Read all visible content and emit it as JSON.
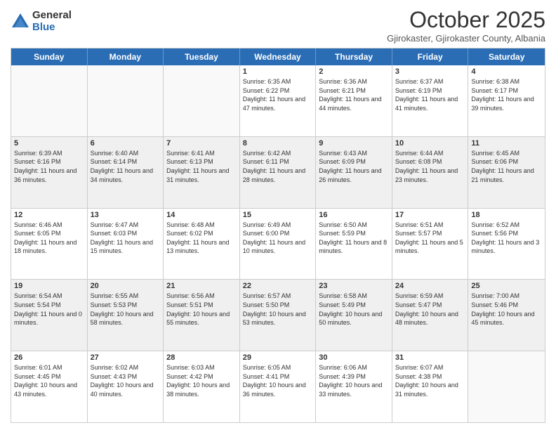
{
  "logo": {
    "general": "General",
    "blue": "Blue"
  },
  "header": {
    "month": "October 2025",
    "subtitle": "Gjirokaster, Gjirokaster County, Albania"
  },
  "days": [
    "Sunday",
    "Monday",
    "Tuesday",
    "Wednesday",
    "Thursday",
    "Friday",
    "Saturday"
  ],
  "rows": [
    [
      {
        "day": "",
        "info": "",
        "empty": true
      },
      {
        "day": "",
        "info": "",
        "empty": true
      },
      {
        "day": "",
        "info": "",
        "empty": true
      },
      {
        "day": "1",
        "info": "Sunrise: 6:35 AM\nSunset: 6:22 PM\nDaylight: 11 hours and 47 minutes.",
        "empty": false
      },
      {
        "day": "2",
        "info": "Sunrise: 6:36 AM\nSunset: 6:21 PM\nDaylight: 11 hours and 44 minutes.",
        "empty": false
      },
      {
        "day": "3",
        "info": "Sunrise: 6:37 AM\nSunset: 6:19 PM\nDaylight: 11 hours and 41 minutes.",
        "empty": false
      },
      {
        "day": "4",
        "info": "Sunrise: 6:38 AM\nSunset: 6:17 PM\nDaylight: 11 hours and 39 minutes.",
        "empty": false
      }
    ],
    [
      {
        "day": "5",
        "info": "Sunrise: 6:39 AM\nSunset: 6:16 PM\nDaylight: 11 hours and 36 minutes.",
        "empty": false
      },
      {
        "day": "6",
        "info": "Sunrise: 6:40 AM\nSunset: 6:14 PM\nDaylight: 11 hours and 34 minutes.",
        "empty": false
      },
      {
        "day": "7",
        "info": "Sunrise: 6:41 AM\nSunset: 6:13 PM\nDaylight: 11 hours and 31 minutes.",
        "empty": false
      },
      {
        "day": "8",
        "info": "Sunrise: 6:42 AM\nSunset: 6:11 PM\nDaylight: 11 hours and 28 minutes.",
        "empty": false
      },
      {
        "day": "9",
        "info": "Sunrise: 6:43 AM\nSunset: 6:09 PM\nDaylight: 11 hours and 26 minutes.",
        "empty": false
      },
      {
        "day": "10",
        "info": "Sunrise: 6:44 AM\nSunset: 6:08 PM\nDaylight: 11 hours and 23 minutes.",
        "empty": false
      },
      {
        "day": "11",
        "info": "Sunrise: 6:45 AM\nSunset: 6:06 PM\nDaylight: 11 hours and 21 minutes.",
        "empty": false
      }
    ],
    [
      {
        "day": "12",
        "info": "Sunrise: 6:46 AM\nSunset: 6:05 PM\nDaylight: 11 hours and 18 minutes.",
        "empty": false
      },
      {
        "day": "13",
        "info": "Sunrise: 6:47 AM\nSunset: 6:03 PM\nDaylight: 11 hours and 15 minutes.",
        "empty": false
      },
      {
        "day": "14",
        "info": "Sunrise: 6:48 AM\nSunset: 6:02 PM\nDaylight: 11 hours and 13 minutes.",
        "empty": false
      },
      {
        "day": "15",
        "info": "Sunrise: 6:49 AM\nSunset: 6:00 PM\nDaylight: 11 hours and 10 minutes.",
        "empty": false
      },
      {
        "day": "16",
        "info": "Sunrise: 6:50 AM\nSunset: 5:59 PM\nDaylight: 11 hours and 8 minutes.",
        "empty": false
      },
      {
        "day": "17",
        "info": "Sunrise: 6:51 AM\nSunset: 5:57 PM\nDaylight: 11 hours and 5 minutes.",
        "empty": false
      },
      {
        "day": "18",
        "info": "Sunrise: 6:52 AM\nSunset: 5:56 PM\nDaylight: 11 hours and 3 minutes.",
        "empty": false
      }
    ],
    [
      {
        "day": "19",
        "info": "Sunrise: 6:54 AM\nSunset: 5:54 PM\nDaylight: 11 hours and 0 minutes.",
        "empty": false
      },
      {
        "day": "20",
        "info": "Sunrise: 6:55 AM\nSunset: 5:53 PM\nDaylight: 10 hours and 58 minutes.",
        "empty": false
      },
      {
        "day": "21",
        "info": "Sunrise: 6:56 AM\nSunset: 5:51 PM\nDaylight: 10 hours and 55 minutes.",
        "empty": false
      },
      {
        "day": "22",
        "info": "Sunrise: 6:57 AM\nSunset: 5:50 PM\nDaylight: 10 hours and 53 minutes.",
        "empty": false
      },
      {
        "day": "23",
        "info": "Sunrise: 6:58 AM\nSunset: 5:49 PM\nDaylight: 10 hours and 50 minutes.",
        "empty": false
      },
      {
        "day": "24",
        "info": "Sunrise: 6:59 AM\nSunset: 5:47 PM\nDaylight: 10 hours and 48 minutes.",
        "empty": false
      },
      {
        "day": "25",
        "info": "Sunrise: 7:00 AM\nSunset: 5:46 PM\nDaylight: 10 hours and 45 minutes.",
        "empty": false
      }
    ],
    [
      {
        "day": "26",
        "info": "Sunrise: 6:01 AM\nSunset: 4:45 PM\nDaylight: 10 hours and 43 minutes.",
        "empty": false
      },
      {
        "day": "27",
        "info": "Sunrise: 6:02 AM\nSunset: 4:43 PM\nDaylight: 10 hours and 40 minutes.",
        "empty": false
      },
      {
        "day": "28",
        "info": "Sunrise: 6:03 AM\nSunset: 4:42 PM\nDaylight: 10 hours and 38 minutes.",
        "empty": false
      },
      {
        "day": "29",
        "info": "Sunrise: 6:05 AM\nSunset: 4:41 PM\nDaylight: 10 hours and 36 minutes.",
        "empty": false
      },
      {
        "day": "30",
        "info": "Sunrise: 6:06 AM\nSunset: 4:39 PM\nDaylight: 10 hours and 33 minutes.",
        "empty": false
      },
      {
        "day": "31",
        "info": "Sunrise: 6:07 AM\nSunset: 4:38 PM\nDaylight: 10 hours and 31 minutes.",
        "empty": false
      },
      {
        "day": "",
        "info": "",
        "empty": true
      }
    ]
  ]
}
